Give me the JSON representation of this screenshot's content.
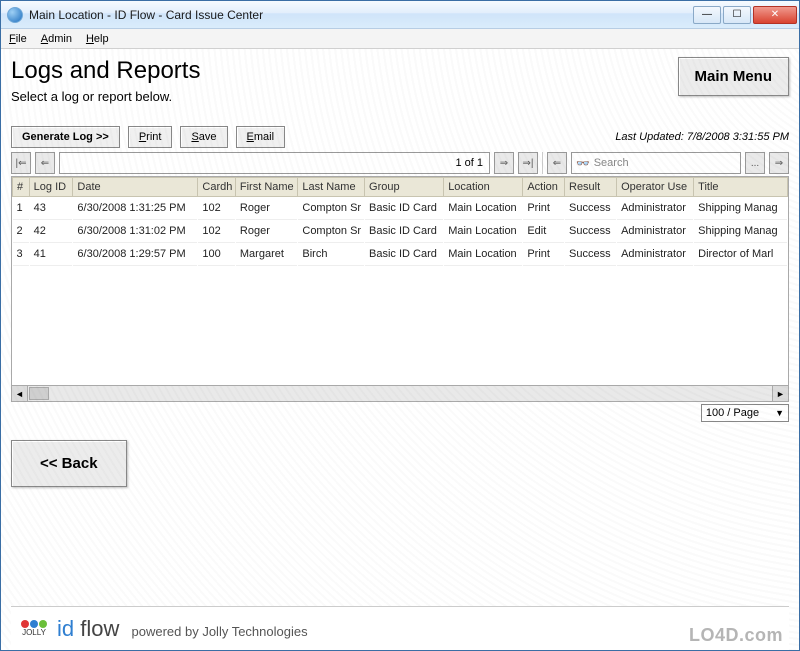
{
  "window": {
    "title": "Main Location - ID Flow - Card Issue Center"
  },
  "menu": {
    "file": "File",
    "admin": "Admin",
    "help": "Help"
  },
  "page": {
    "title": "Logs and Reports",
    "subtitle": "Select a log or report below.",
    "main_menu_btn": "Main Menu",
    "back_btn": "<< Back"
  },
  "toolbar": {
    "generate": "Generate Log >>",
    "print": "Print",
    "save": "Save",
    "email": "Email",
    "last_updated": "Last Updated: 7/8/2008 3:31:55 PM"
  },
  "pager": {
    "page_text": "1 of 1",
    "search_placeholder": "Search",
    "ellipsis": "..."
  },
  "columns": {
    "num": "#",
    "log_id": "Log ID",
    "date": "Date",
    "cardh": "Cardh",
    "first": "First Name",
    "last": "Last Name",
    "group": "Group",
    "location": "Location",
    "action": "Action",
    "result": "Result",
    "operator": "Operator Use",
    "title": "Title"
  },
  "rows": [
    {
      "num": "1",
      "log_id": "43",
      "date": "6/30/2008 1:31:25 PM",
      "cardh": "102",
      "first": "Roger",
      "last": "Compton Sr",
      "group": "Basic ID Card",
      "location": "Main Location",
      "action": "Print",
      "result": "Success",
      "operator": "Administrator",
      "title": "Shipping Manag"
    },
    {
      "num": "2",
      "log_id": "42",
      "date": "6/30/2008 1:31:02 PM",
      "cardh": "102",
      "first": "Roger",
      "last": "Compton Sr",
      "group": "Basic ID Card",
      "location": "Main Location",
      "action": "Edit",
      "result": "Success",
      "operator": "Administrator",
      "title": "Shipping Manag"
    },
    {
      "num": "3",
      "log_id": "41",
      "date": "6/30/2008 1:29:57 PM",
      "cardh": "100",
      "first": "Margaret",
      "last": "Birch",
      "group": "Basic ID Card",
      "location": "Main Location",
      "action": "Print",
      "result": "Success",
      "operator": "Administrator",
      "title": "Director of Marl"
    }
  ],
  "per_page": "100 / Page",
  "footer": {
    "jolly": "JOLLY",
    "brand_id": "id",
    "brand_flow": "flow",
    "powered": "powered by Jolly Technologies",
    "watermark": "LO4D.com"
  }
}
